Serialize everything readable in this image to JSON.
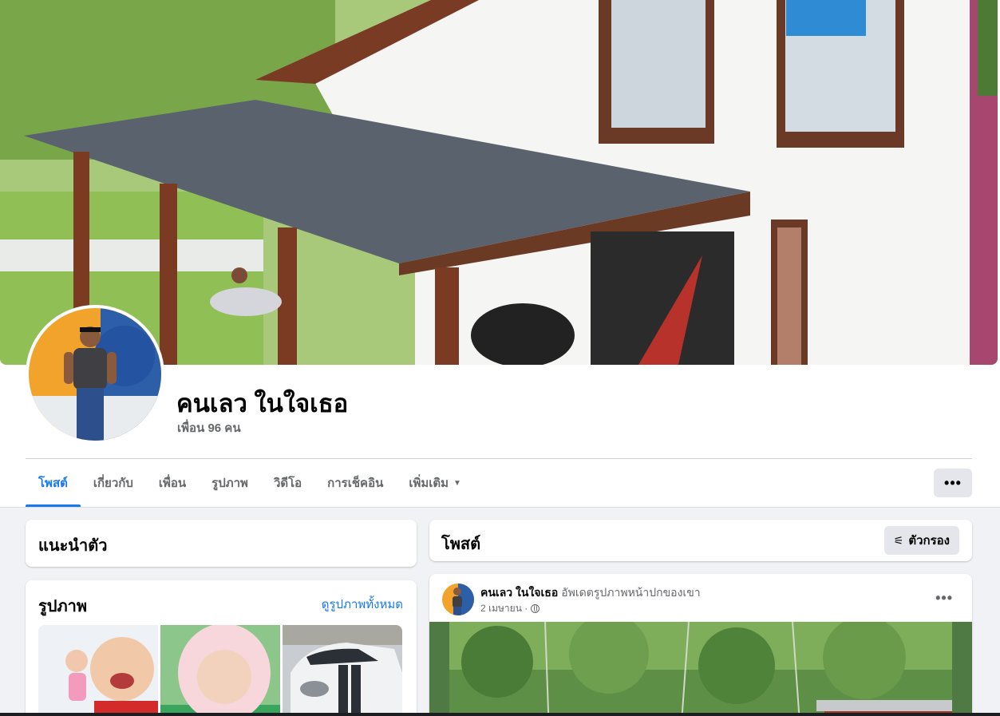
{
  "profile": {
    "name": "คนเลว ในใจเธอ",
    "friends": "เพื่อน 96 คน"
  },
  "tabs": [
    {
      "label": "โพสต์",
      "active": true
    },
    {
      "label": "เกี่ยวกับ"
    },
    {
      "label": "เพื่อน"
    },
    {
      "label": "รูปภาพ"
    },
    {
      "label": "วิดีโอ"
    },
    {
      "label": "การเช็คอิน"
    },
    {
      "label": "เพิ่มเติม"
    }
  ],
  "more_button": "•••",
  "intro": {
    "title": "แนะนำตัว"
  },
  "photos": {
    "title": "รูปภาพ",
    "see_all": "ดูรูปภาพทั้งหมด"
  },
  "posts": {
    "title": "โพสต์",
    "filter_label": "ตัวกรอง"
  },
  "post": {
    "author": "คนเลว ในใจเธอ",
    "action": "อัพเดตรูปภาพหน้าปกของเขา",
    "date": "2 เมษายน ·",
    "dots": "•••"
  },
  "colors": {
    "accent": "#1877f2",
    "secondary_text": "#65676b",
    "page_bg": "#f0f2f5",
    "button_bg": "#e4e6eb"
  },
  "icons": [
    "caret-down-icon",
    "more-dots-icon",
    "filter-icon",
    "globe-icon"
  ]
}
